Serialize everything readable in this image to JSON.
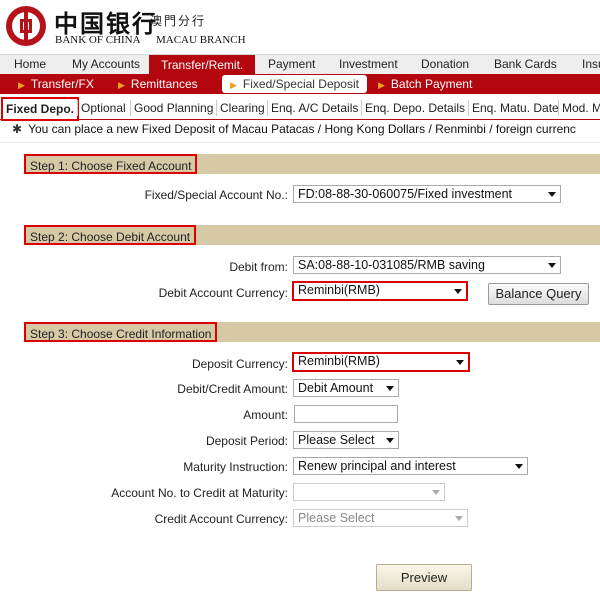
{
  "header": {
    "bank_name_cn": "中国银行",
    "branch_cn": "澳門分行",
    "bank_name_en": "BANK OF CHINA",
    "branch_en": "MACAU BRANCH"
  },
  "main_nav": [
    "Home",
    "My Accounts",
    "Transfer/Remit.",
    "Payment",
    "Investment",
    "Donation",
    "Bank Cards",
    "Insu"
  ],
  "sub_nav": [
    "Transfer/FX",
    "Remittances",
    "Fixed/Special Deposit",
    "Batch Payment"
  ],
  "tabs": [
    "Fixed Depo.",
    "Optional",
    "Good Planning",
    "Clearing",
    "Enq. A/C Details",
    "Enq. Depo. Details",
    "Enq. Matu. Date",
    "Mod. Ma"
  ],
  "notice": "You can place a new Fixed Deposit of Macau Patacas / Hong Kong Dollars / Renminbi / foreign currenc",
  "step1": {
    "title": "Step 1: Choose Fixed Account",
    "account_label": "Fixed/Special Account No.:",
    "account_value": "FD:08-88-30-060075/Fixed investment"
  },
  "step2": {
    "title": "Step 2: Choose Debit Account",
    "debit_from_label": "Debit from:",
    "debit_from_value": "SA:08-88-10-031085/RMB saving",
    "currency_label": "Debit Account Currency:",
    "currency_value": "Reminbi(RMB)",
    "balance_button": "Balance Query"
  },
  "step3": {
    "title": "Step 3: Choose Credit Information",
    "deposit_currency_label": "Deposit Currency:",
    "deposit_currency_value": "Reminbi(RMB)",
    "amount_type_label": "Debit/Credit Amount:",
    "amount_type_value": "Debit Amount",
    "amount_label": "Amount:",
    "amount_value": "",
    "period_label": "Deposit Period:",
    "period_value": "Please Select",
    "maturity_label": "Maturity Instruction:",
    "maturity_value": "Renew principal and interest",
    "credit_account_label": "Account No. to Credit at Maturity:",
    "credit_account_value": "",
    "credit_currency_label": "Credit Account Currency:",
    "credit_currency_value": "Please Select"
  },
  "preview_button": "Preview"
}
